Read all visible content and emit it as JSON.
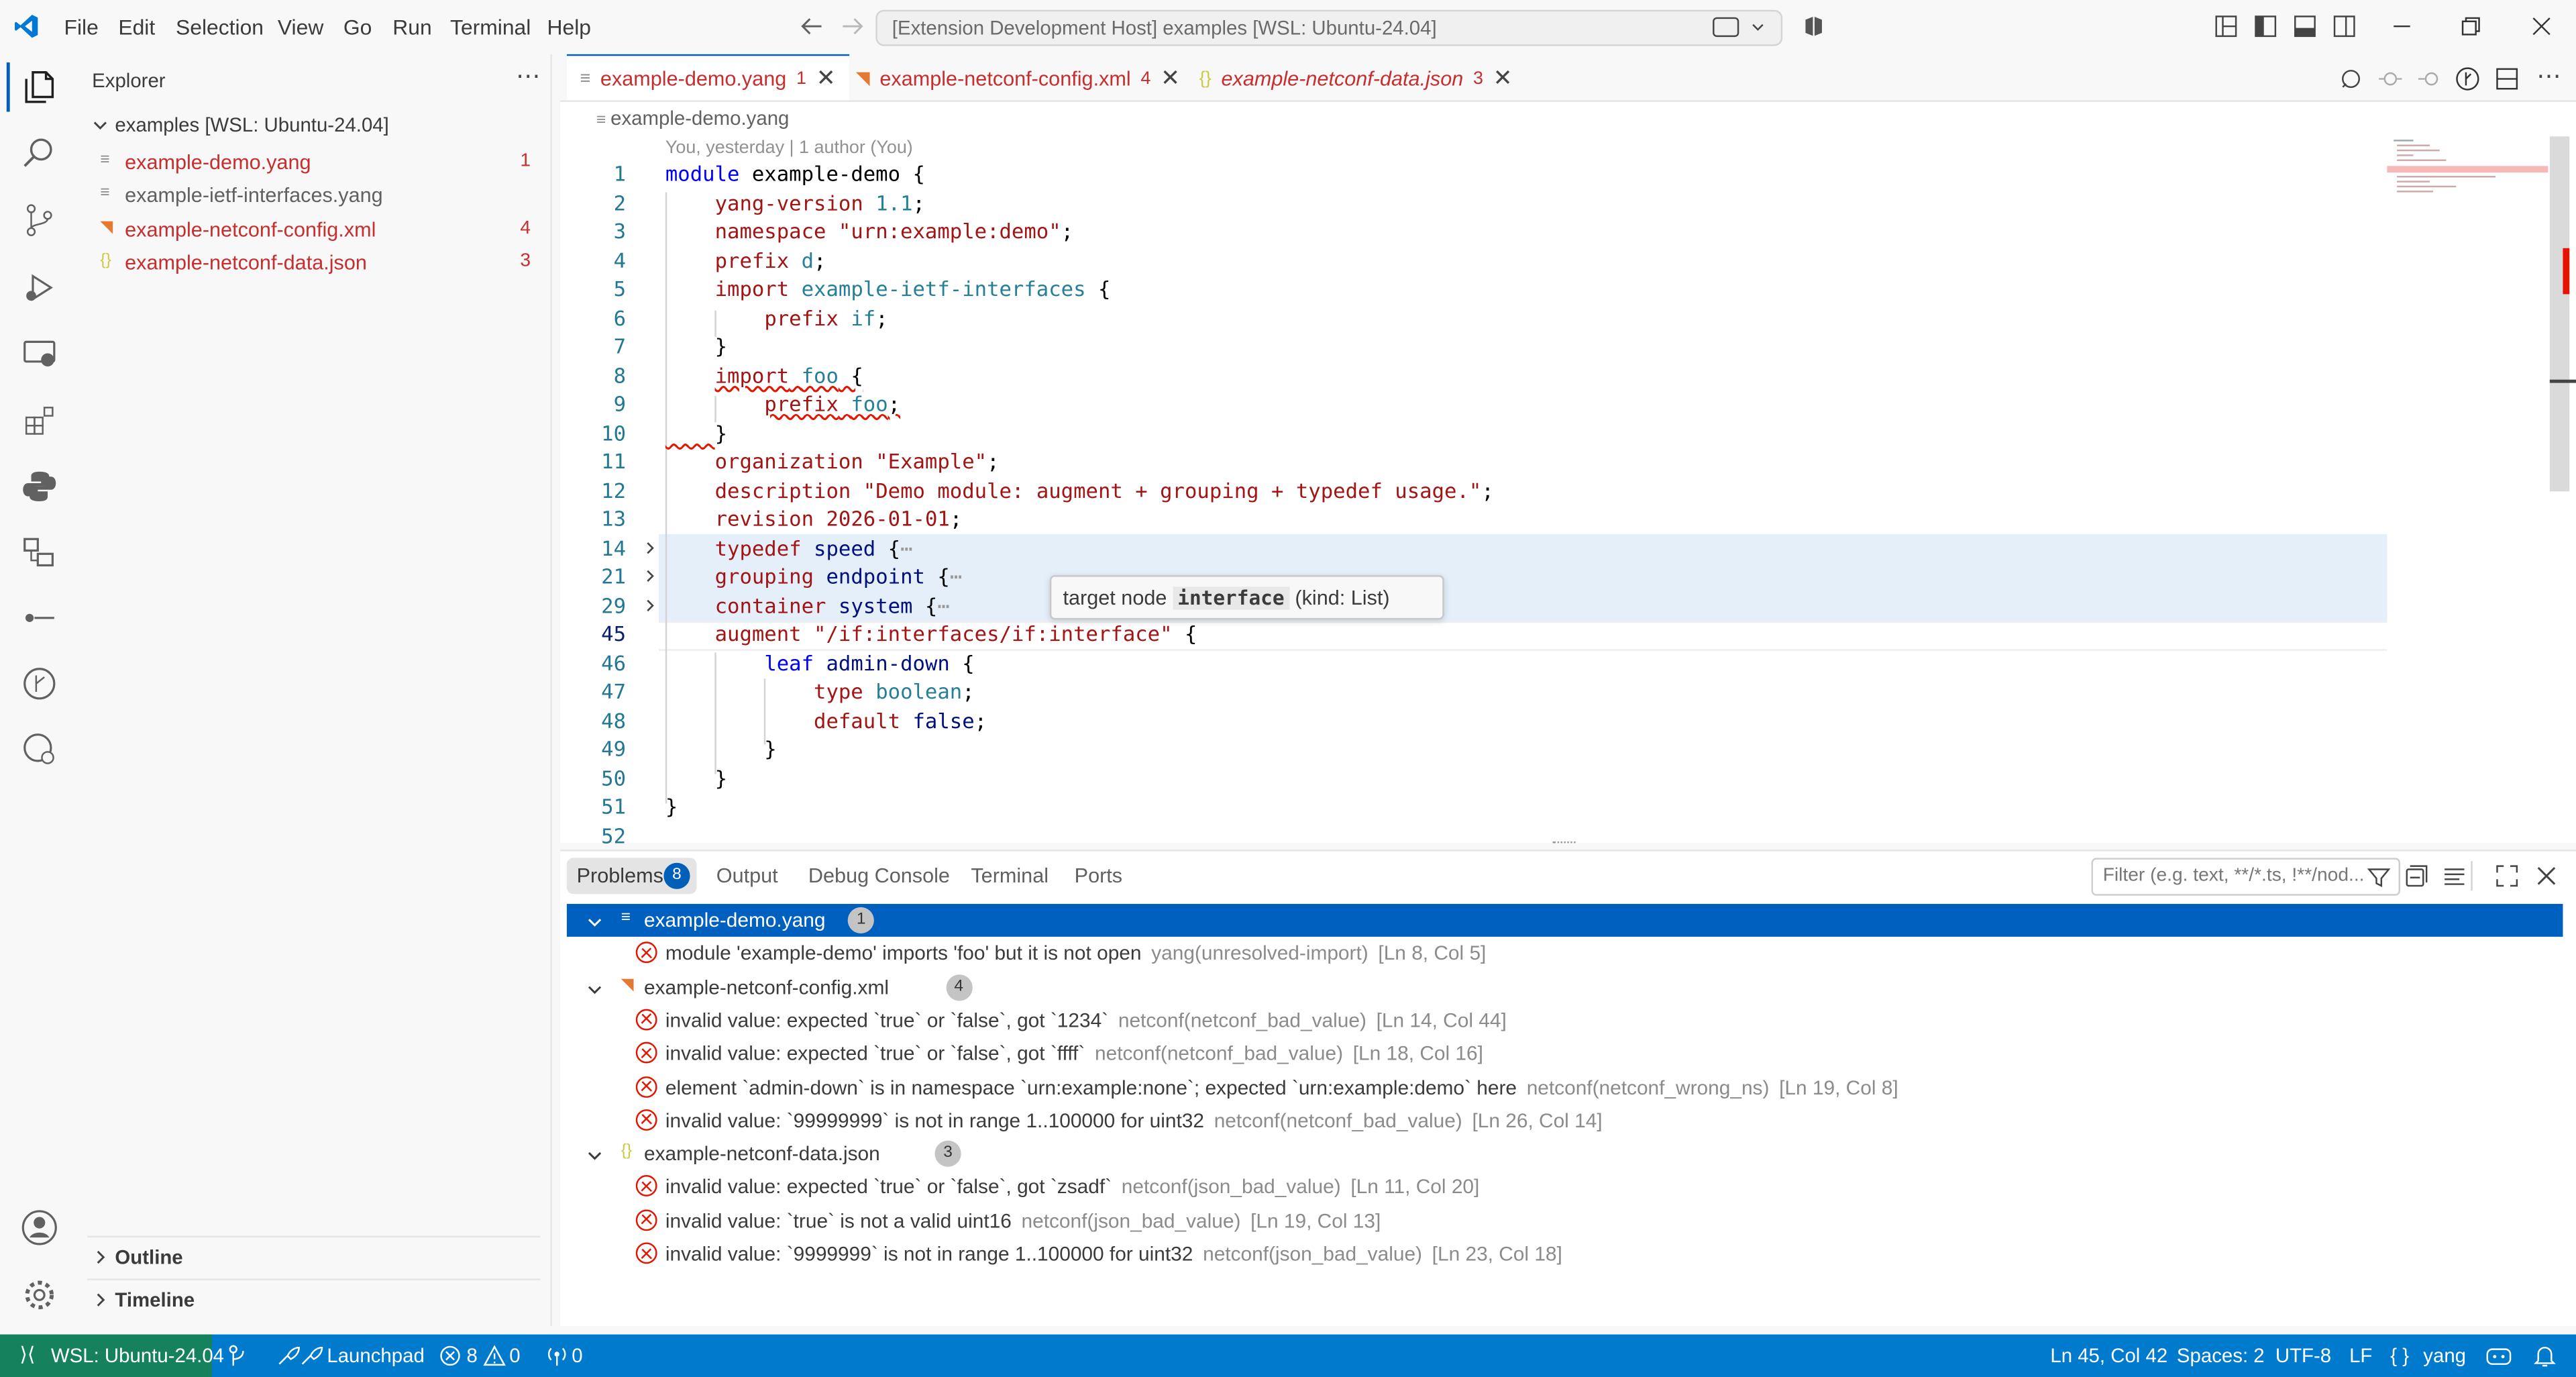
{
  "menu": [
    "File",
    "Edit",
    "Selection",
    "View",
    "Go",
    "Run",
    "Terminal",
    "Help"
  ],
  "command_center": "[Extension Development Host] examples [WSL: Ubuntu-24.04]",
  "sidebar": {
    "title": "Explorer",
    "folder": "examples [WSL: Ubuntu-24.04]",
    "files": [
      {
        "name": "example-demo.yang",
        "badge": "1",
        "icon": "yang-icon",
        "color": "#c72e2e"
      },
      {
        "name": "example-ietf-interfaces.yang",
        "badge": "",
        "icon": "yang-icon",
        "color": "#616161"
      },
      {
        "name": "example-netconf-config.xml",
        "badge": "4",
        "icon": "rss-icon",
        "color": "#c72e2e"
      },
      {
        "name": "example-netconf-data.json",
        "badge": "3",
        "icon": "json-icon",
        "color": "#c72e2e"
      }
    ],
    "outline": "Outline",
    "timeline": "Timeline"
  },
  "tabs": [
    {
      "label": "example-demo.yang",
      "badge": "1"
    },
    {
      "label": "example-netconf-config.xml",
      "badge": "4"
    },
    {
      "label": "example-netconf-data.json",
      "badge": "3"
    }
  ],
  "breadcrumb": "example-demo.yang",
  "blame": "You, yesterday | 1 author (You)",
  "line_numbers": [
    "1",
    "2",
    "3",
    "4",
    "5",
    "6",
    "7",
    "8",
    "9",
    "10",
    "11",
    "12",
    "13",
    "14",
    "21",
    "29",
    "45",
    "46",
    "47",
    "48",
    "49",
    "50",
    "51",
    "52"
  ],
  "hover": {
    "prefix": "target node",
    "node": "interface",
    "suffix": "(kind: List)"
  },
  "panel": {
    "tabs": [
      "Problems",
      "Output",
      "Debug Console",
      "Terminal",
      "Ports"
    ],
    "problem_count": "8",
    "filter_placeholder": "Filter (e.g. text, **/*.ts, !**/nod...",
    "groups": [
      {
        "file": "example-demo.yang",
        "count": "1",
        "items": [
          {
            "msg": "module 'example-demo' imports 'foo' but it is not open",
            "src": "yang(unresolved-import)",
            "pos": "[Ln 8, Col 5]"
          }
        ]
      },
      {
        "file": "example-netconf-config.xml",
        "count": "4",
        "items": [
          {
            "msg": "invalid value: expected `true` or `false`, got `1234`",
            "src": "netconf(netconf_bad_value)",
            "pos": "[Ln 14, Col 44]"
          },
          {
            "msg": "invalid value: expected `true` or `false`, got `ffff`",
            "src": "netconf(netconf_bad_value)",
            "pos": "[Ln 18, Col 16]"
          },
          {
            "msg": "element `admin-down` is in namespace `urn:example:none`; expected `urn:example:demo` here",
            "src": "netconf(netconf_wrong_ns)",
            "pos": "[Ln 19, Col 8]"
          },
          {
            "msg": "invalid value: `99999999` is not in range 1..100000 for uint32",
            "src": "netconf(netconf_bad_value)",
            "pos": "[Ln 26, Col 14]"
          }
        ]
      },
      {
        "file": "example-netconf-data.json",
        "count": "3",
        "items": [
          {
            "msg": "invalid value: expected `true` or `false`, got `zsadf`",
            "src": "netconf(json_bad_value)",
            "pos": "[Ln 11, Col 20]"
          },
          {
            "msg": "invalid value: `true` is not a valid uint16",
            "src": "netconf(json_bad_value)",
            "pos": "[Ln 19, Col 13]"
          },
          {
            "msg": "invalid value: `9999999` is not in range 1..100000 for uint32",
            "src": "netconf(json_bad_value)",
            "pos": "[Ln 23, Col 18]"
          }
        ]
      }
    ]
  },
  "status": {
    "remote": "WSL: Ubuntu-24.04",
    "launchpad": "Launchpad",
    "errors": "8",
    "warnings": "0",
    "ports": "0",
    "cursor": "Ln 45, Col 42",
    "spaces": "Spaces: 2",
    "encoding": "UTF-8",
    "eol": "LF",
    "language": "yang"
  },
  "colors": {
    "accent": "#007acc",
    "error": "#e51400",
    "selection": "#0060c0"
  }
}
